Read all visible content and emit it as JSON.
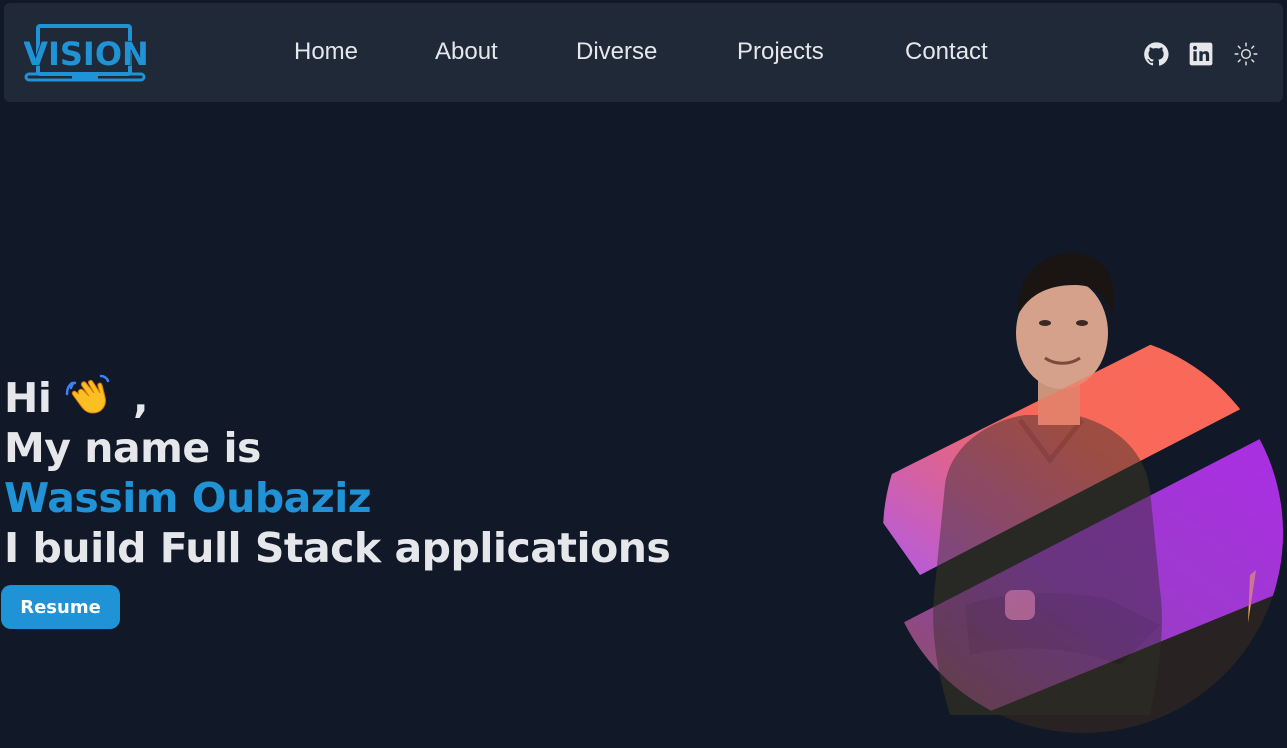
{
  "brand": {
    "logo_text": "VISION",
    "logo_color": "#1f93d6"
  },
  "nav": {
    "links": [
      "Home",
      "About",
      "Diverse",
      "Projects",
      "Contact"
    ],
    "icons": [
      "github-icon",
      "linkedin-icon",
      "sun-icon"
    ]
  },
  "hero": {
    "greeting": "Hi",
    "greeting_suffix": ",",
    "intro": "My name is",
    "name": "Wassim Oubaziz",
    "tagline": "I build Full Stack applications",
    "resume_label": "Resume"
  },
  "colors": {
    "background": "#111827",
    "navbar": "#1f2937",
    "accent": "#1f93d6",
    "text": "#e5e7eb",
    "gradient_orange": "#ff6b5b",
    "gradient_purple": "#b42ff0",
    "gradient_gold": "#f6b04a"
  }
}
